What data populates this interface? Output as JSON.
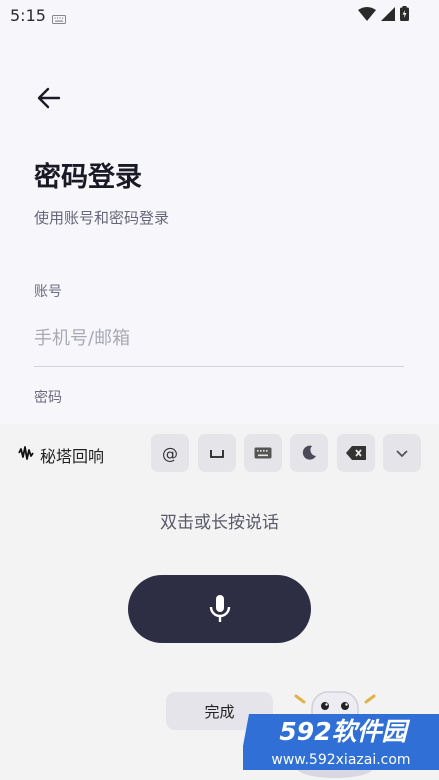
{
  "status": {
    "time": "5:15"
  },
  "page": {
    "title": "密码登录",
    "subtitle": "使用账号和密码登录",
    "account_label": "账号",
    "account_placeholder": "手机号/邮箱",
    "password_label": "密码"
  },
  "keyboard": {
    "brand": "秘塔回响",
    "toolbar": [
      "@",
      "space-key-icon",
      "keyboard-icon",
      "moon-icon",
      "backspace-icon",
      "chevron-down-icon"
    ],
    "at_label": "@",
    "hint": "双击或长按说话",
    "done_label": "完成"
  },
  "watermark": {
    "brand": "592软件园",
    "url": "www.592xiazai.com"
  },
  "colors": {
    "mic_button": "#2d2d44",
    "watermark_blue": "#2f6fd6"
  }
}
